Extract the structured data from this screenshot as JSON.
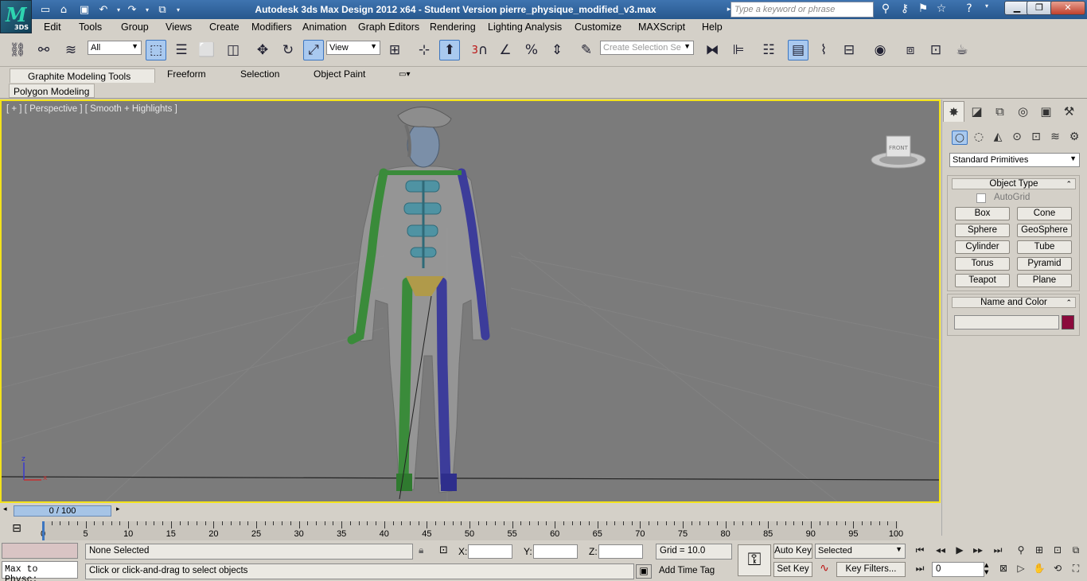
{
  "app": {
    "logo_text": "3DS",
    "window_title": "Autodesk 3ds Max Design 2012 x64  -  Student Version    pierre_physique_modified_v3.max",
    "search_placeholder": "Type a keyword or phrase"
  },
  "menubar": [
    "Edit",
    "Tools",
    "Group",
    "Views",
    "Create",
    "Modifiers",
    "Animation",
    "Graph Editors",
    "Rendering",
    "Lighting Analysis",
    "Customize",
    "MAXScript",
    "Help"
  ],
  "toolbar": {
    "selection_filter": "All",
    "reference_coord": "View",
    "create_selection_set_placeholder": "Create Selection Se",
    "snap_label": "3"
  },
  "ribbon": {
    "tabs": [
      "Graphite Modeling Tools",
      "Freeform",
      "Selection",
      "Object Paint"
    ],
    "panel": "Polygon Modeling"
  },
  "viewport": {
    "label": "[ + ] [ Perspective ] [ Smooth + Highlights ]",
    "viewcube_face": "FRONT",
    "axis_z": "z",
    "axis_x": "x"
  },
  "command_panel": {
    "category": "Standard Primitives",
    "object_type_title": "Object Type",
    "autogrid_label": "AutoGrid",
    "buttons": [
      "Box",
      "Cone",
      "Sphere",
      "GeoSphere",
      "Cylinder",
      "Tube",
      "Torus",
      "Pyramid",
      "Teapot",
      "Plane"
    ],
    "name_color_title": "Name and Color",
    "object_color": "#8b0a3c"
  },
  "timeline": {
    "slider_label": "0 / 100",
    "ticks": [
      0,
      5,
      10,
      15,
      20,
      25,
      30,
      35,
      40,
      45,
      50,
      55,
      60,
      65,
      70,
      75,
      80,
      85,
      90,
      95,
      100
    ]
  },
  "status": {
    "maxscript_listener": "Max to Physc:",
    "selection_status": "None Selected",
    "prompt": "Click or click-and-drag to select objects",
    "x_label": "X:",
    "y_label": "Y:",
    "z_label": "Z:",
    "grid": "Grid = 10.0",
    "add_time_tag": "Add Time Tag",
    "auto_key": "Auto Key",
    "set_key": "Set Key",
    "key_mode": "Selected",
    "key_filters": "Key Filters...",
    "current_frame": "0"
  }
}
